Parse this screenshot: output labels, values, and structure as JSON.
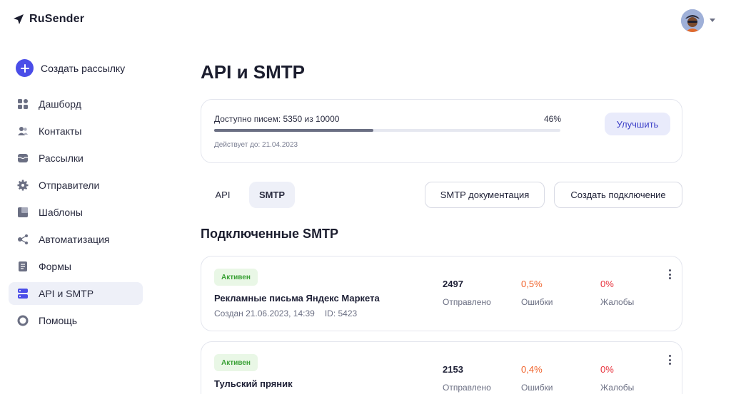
{
  "app": {
    "name": "RuSender"
  },
  "sidebar": {
    "create_label": "Создать рассылку",
    "items": [
      {
        "label": "Дашборд",
        "icon": "dashboard-icon"
      },
      {
        "label": "Контакты",
        "icon": "contacts-icon"
      },
      {
        "label": "Рассылки",
        "icon": "mailings-icon"
      },
      {
        "label": "Отправители",
        "icon": "gear-icon"
      },
      {
        "label": "Шаблоны",
        "icon": "templates-icon"
      },
      {
        "label": "Автоматизация",
        "icon": "automation-icon"
      },
      {
        "label": "Формы",
        "icon": "forms-icon"
      },
      {
        "label": "API и SMTP",
        "icon": "api-icon",
        "active": true
      },
      {
        "label": "Помощь",
        "icon": "help-icon"
      }
    ]
  },
  "page": {
    "title": "API и SMTP"
  },
  "quota": {
    "text": "Доступно писем: 5350 из 10000",
    "percent_label": "46%",
    "percent": 46,
    "valid_until": "Действует до: 21.04.2023",
    "upgrade_label": "Улучшить"
  },
  "tabs": {
    "api": "API",
    "smtp": "SMTP"
  },
  "actions": {
    "docs": "SMTP документация",
    "create": "Создать подключение"
  },
  "section_title": "Подключенные SMTP",
  "connections": [
    {
      "status": "Активен",
      "name": "Рекламные письма Яндекс Маркета",
      "created": "Создан 21.06.2023, 14:39",
      "id": "ID: 5423",
      "sent": "2497",
      "sent_label": "Отправлено",
      "errors": "0,5%",
      "errors_label": "Ошибки",
      "complaints": "0%",
      "complaints_label": "Жалобы"
    },
    {
      "status": "Активен",
      "name": "Тульский пряник",
      "sent": "2153",
      "sent_label": "Отправлено",
      "errors": "0,4%",
      "errors_label": "Ошибки",
      "complaints": "0%",
      "complaints_label": "Жалобы"
    }
  ],
  "colors": {
    "accent": "#4a4de8",
    "active_badge": "#3aa136",
    "error": "#f0622a",
    "complaint": "#e8333d"
  }
}
